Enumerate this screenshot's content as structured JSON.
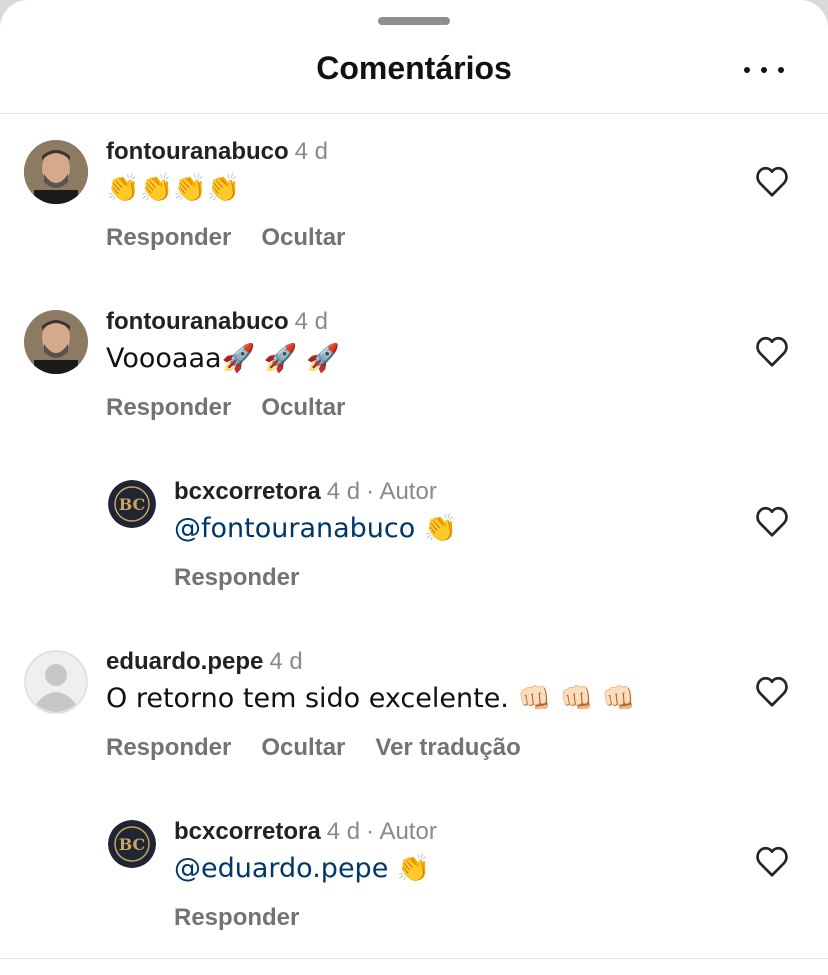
{
  "header": {
    "title": "Comentários",
    "more_icon": "more-horizontal-icon"
  },
  "comments": [
    {
      "username": "fontouranabuco",
      "time": "4 d",
      "author_tag": "",
      "mention": "",
      "text": "👏👏👏👏",
      "actions": [
        "Responder",
        "Ocultar"
      ]
    },
    {
      "username": "fontouranabuco",
      "time": "4 d",
      "author_tag": "",
      "mention": "",
      "text": "Voooaaa🚀 🚀 🚀",
      "actions": [
        "Responder",
        "Ocultar"
      ]
    },
    {
      "username": "bcxcorretora",
      "time": "4 d",
      "author_tag": "· Autor",
      "mention": "@fontouranabuco",
      "text": " 👏",
      "actions": [
        "Responder"
      ]
    },
    {
      "username": "eduardo.pepe",
      "time": "4 d",
      "author_tag": "",
      "mention": "",
      "text": "O retorno tem sido excelente. 👊🏻 👊🏻 👊🏻",
      "actions": [
        "Responder",
        "Ocultar",
        "Ver tradução"
      ]
    },
    {
      "username": "bcxcorretora",
      "time": "4 d",
      "author_tag": "· Autor",
      "mention": "@eduardo.pepe",
      "text": " 👏",
      "actions": [
        "Responder"
      ]
    }
  ],
  "brand_avatar_text": "BC",
  "colors": {
    "mention": "#00376b",
    "secondary_text": "#737373",
    "meta_text": "#8a8a8a",
    "brand_dark": "#1f2535",
    "brand_gold": "#c8a45a"
  }
}
